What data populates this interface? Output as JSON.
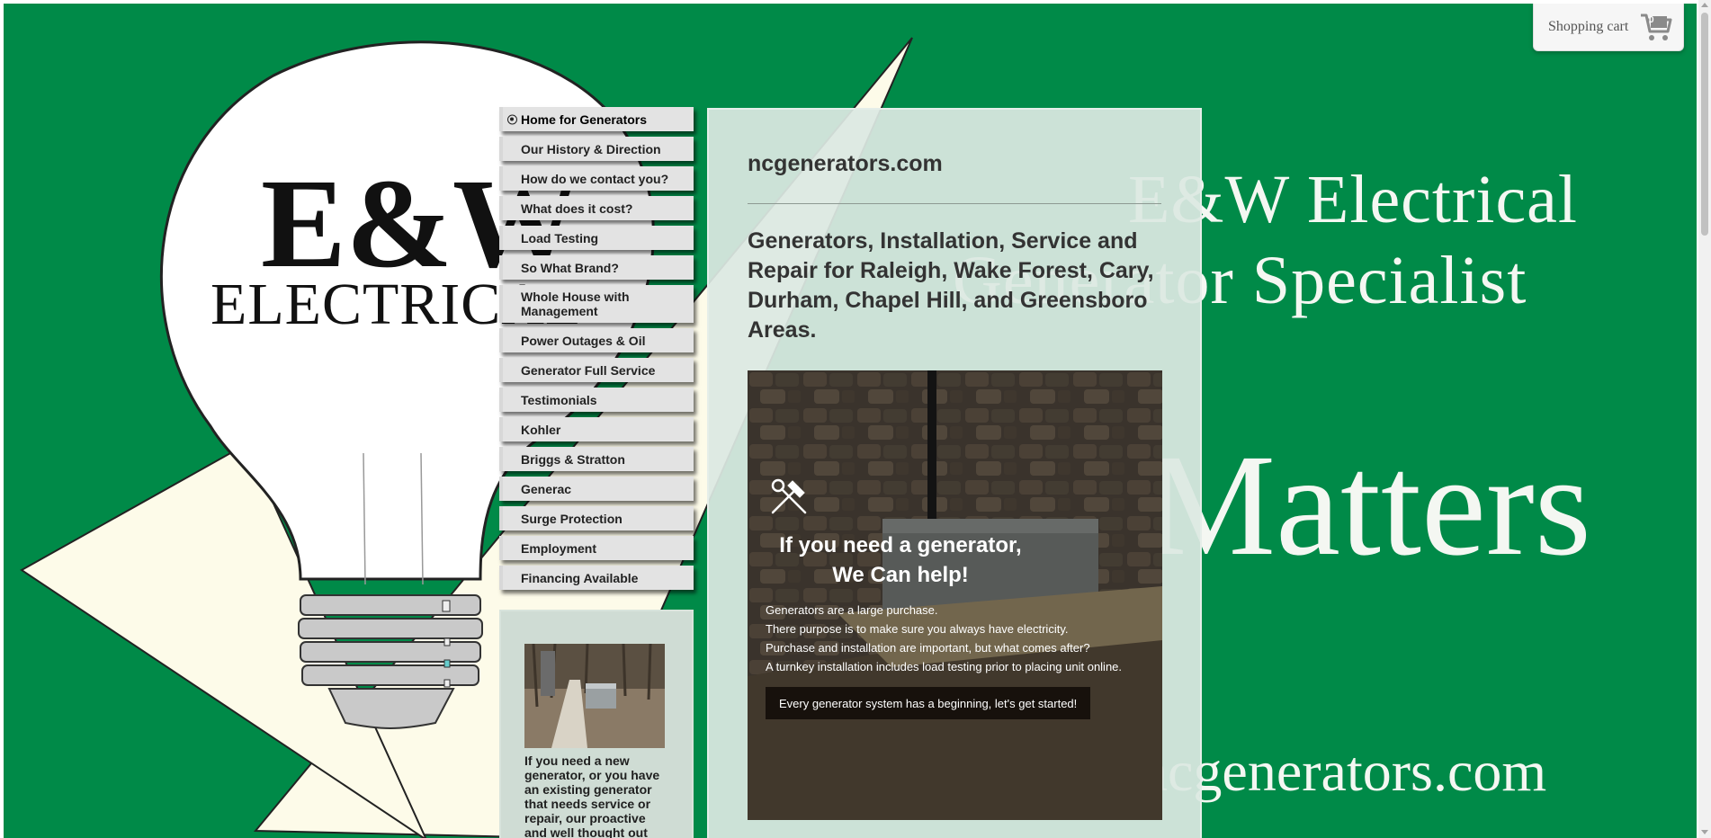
{
  "hero": {
    "logo_line1": "E&W",
    "logo_line2": "ELECTRICAL",
    "title_line1": "E&W Electrical",
    "title_line2": "Generator Specialist",
    "big_word": "Matters",
    "domain": "ncgenerators.com"
  },
  "nav": {
    "items": [
      {
        "label": "Home for Generators",
        "active": true
      },
      {
        "label": "Our History & Direction"
      },
      {
        "label": "How do we contact you?"
      },
      {
        "label": "What does it cost?"
      },
      {
        "label": "Load Testing"
      },
      {
        "label": "So What Brand?"
      },
      {
        "label": "Whole House with Management"
      },
      {
        "label": "Power Outages & Oil"
      },
      {
        "label": "Generator Full Service"
      },
      {
        "label": "Testimonials"
      },
      {
        "label": "Kohler"
      },
      {
        "label": "Briggs & Stratton"
      },
      {
        "label": "Generac"
      },
      {
        "label": "Surge Protection"
      },
      {
        "label": "Employment"
      },
      {
        "label": "Financing Available"
      }
    ]
  },
  "side": {
    "text": "If you need a new generator, or you have an existing generator that needs service or repair, our proactive and well thought out"
  },
  "main": {
    "site_name": "ncgenerators.com",
    "tagline": "Generators, Installation, Service and Repair for Raleigh, Wake Forest, Cary, Durham, Chapel Hill, and Greensboro Areas.",
    "feature": {
      "icon": "hammer-wrench-icon",
      "heading_line1": "If you need a generator,",
      "heading_line2": "We Can help!",
      "body": [
        "Generators are a large purchase.",
        "There purpose is to make sure you always have electricity.",
        "Purchase and installation are important, but what comes after?",
        "A turnkey installation includes load testing prior to placing unit online."
      ],
      "cta": "Every generator system has a beginning, let's get started!"
    }
  },
  "cart": {
    "label": "Shopping cart",
    "count": "0",
    "icon": "cart-icon"
  },
  "colors": {
    "background_green": "#008a48",
    "bulb_cream": "#fdfbe9",
    "panel": "#dce8e2"
  }
}
